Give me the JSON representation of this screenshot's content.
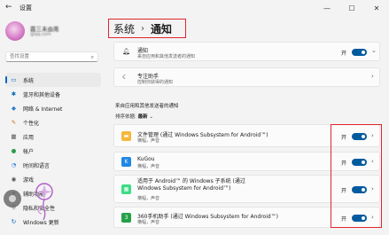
{
  "window": {
    "back": "←",
    "title": "设置",
    "minimize": "—",
    "maximize": "☐",
    "close": "✕"
  },
  "profile": {
    "name": "霞三未由南",
    "email": "@qq.com"
  },
  "search": {
    "placeholder": "查找设置",
    "icon": "search-icon"
  },
  "nav": [
    {
      "label": "系统",
      "icon": "monitor-icon",
      "glyph": "▭",
      "color": "#0067c0",
      "active": true
    },
    {
      "label": "蓝牙和其他设备",
      "icon": "bluetooth-icon",
      "glyph": "✱",
      "color": "#0067c0"
    },
    {
      "label": "网络 & Internet",
      "icon": "wifi-icon",
      "glyph": "◆",
      "color": "#2b7bd4"
    },
    {
      "label": "个性化",
      "icon": "brush-icon",
      "glyph": "✎",
      "color": "#c77a1b"
    },
    {
      "label": "应用",
      "icon": "apps-icon",
      "glyph": "▦",
      "color": "#555555"
    },
    {
      "label": "帐户",
      "icon": "person-icon",
      "glyph": "●",
      "color": "#2c9c4d"
    },
    {
      "label": "时间和语言",
      "icon": "globe-icon",
      "glyph": "◔",
      "color": "#2b7bd4"
    },
    {
      "label": "游戏",
      "icon": "gamepad-icon",
      "glyph": "◉",
      "color": "#555555"
    },
    {
      "label": "辅助功能",
      "icon": "accessibility-icon",
      "glyph": "✦",
      "color": "#2b7bd4"
    },
    {
      "label": "隐私和安全性",
      "icon": "shield-icon",
      "glyph": "⛨",
      "color": "#555555"
    },
    {
      "label": "Windows 更新",
      "icon": "update-icon",
      "glyph": "↻",
      "color": "#0067c0"
    }
  ],
  "header": {
    "parent": "系统",
    "separator": "›",
    "current": "通知"
  },
  "notifications": {
    "title": "通知",
    "subtitle": "来自应用和其他发送者的通知",
    "state": "开",
    "icon": "bell-icon",
    "chevron": "⌄"
  },
  "focus": {
    "title": "专注助手",
    "subtitle": "控制你获得的通知",
    "icon": "moon-icon",
    "chevron": "›"
  },
  "apps_section": {
    "label": "来自应用和其他发送者的通知",
    "sort_label": "排序依据:",
    "sort_value": "最新",
    "sort_chevron": "⌄"
  },
  "apps": [
    {
      "title": "文件管理 (通过 Windows Subsystem for Android™)",
      "subtitle": "横幅，声音",
      "state": "开",
      "icon": "folder-icon",
      "glyph": "▬",
      "color": "#f5b83d"
    },
    {
      "title": "KuGou",
      "subtitle": "横幅，声音",
      "state": "开",
      "icon": "kugou-icon",
      "glyph": "K",
      "color": "#1e88e5"
    },
    {
      "title": "适用于 Android™ 的 Windows 子系统 (通过 Windows Subsystem for Android™)",
      "subtitle": "横幅，声音",
      "state": "开",
      "icon": "android-subsystem-icon",
      "glyph": "▦",
      "color": "#3ddc84"
    },
    {
      "title": "360手机助手 (通过 Windows Subsystem for Android™)",
      "subtitle": "横幅，声音",
      "state": "开",
      "icon": "360-icon",
      "glyph": "3",
      "color": "#24a148"
    }
  ],
  "colors": {
    "accent": "#0067c0",
    "toggle_on": "#005a9e",
    "highlight": "#e0262d"
  }
}
